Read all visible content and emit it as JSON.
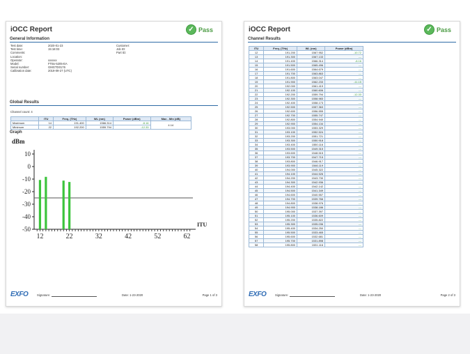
{
  "report_title": "iOCC Report",
  "pass_label": "Pass",
  "colors": {
    "accent": "#2d6aa5",
    "pass_green": "#4b9b43",
    "bar_green": "#3cc43c",
    "brand_blue": "#2f6cb5"
  },
  "page1": {
    "general_title": "General Information",
    "info_left": [
      {
        "key": "Test date:",
        "value": "2020-01-23"
      },
      {
        "key": "Test time:",
        "value": "15:18:03"
      },
      {
        "key": "Comments:",
        "value": ""
      },
      {
        "key": "Location:",
        "value": ""
      },
      {
        "key": "Operator:",
        "value": "xxxxxx"
      },
      {
        "key": "Model:",
        "value": "FTBx-5205-EA"
      },
      {
        "key": "Serial number:",
        "value": "GMGTD0176"
      },
      {
        "key": "Calibration date:",
        "value": "2019-09-27 (UTC)"
      }
    ],
    "info_right": [
      {
        "key": "Customer:",
        "value": ""
      },
      {
        "key": "Job ID:",
        "value": ""
      },
      {
        "key": "Part ID:",
        "value": ""
      }
    ],
    "global_title": "Global Results",
    "channel_count_label": "Channel count:",
    "channel_count": "4",
    "summary_headers": [
      "",
      "ITU",
      "Freq. (THz)",
      "WL (nm)",
      "Power (dBm)",
      "Max - Min (dB)"
    ],
    "summary_rows": [
      {
        "label": "Maximum",
        "itu": "14",
        "freq": "191.400",
        "wl": "1566.314",
        "power": "-8.16"
      },
      {
        "label": "Minimum",
        "itu": "22",
        "freq": "192.200",
        "wl": "1559.794",
        "power": "-12.33"
      }
    ],
    "max_min": "4.14",
    "graph_title": "Graph",
    "footer": {
      "signature_label": "Signature:",
      "date": "Date: 1-23-2020",
      "page": "Page 1 of 3"
    }
  },
  "chart_data": {
    "type": "bar",
    "ylabel": "dBm",
    "xlabel": "ITU",
    "ylim": [
      -50,
      10
    ],
    "xlim": [
      10,
      64
    ],
    "yticks": [
      10,
      0,
      -10,
      -20,
      -30,
      -40,
      -50
    ],
    "xticks": [
      12,
      22,
      32,
      42,
      52,
      62
    ],
    "threshold": -25,
    "x": [
      12,
      14,
      20,
      22
    ],
    "values": [
      -10.7,
      -8.2,
      -11.2,
      -12.3
    ]
  },
  "page2": {
    "channel_title": "Channel Results",
    "headers": [
      "ITU",
      "Freq. (THz)",
      "WL (nm)",
      "Power (dBm)"
    ],
    "rows": [
      [
        "12",
        "191.200",
        "1567.952",
        "-10.72"
      ],
      [
        "13",
        "191.300",
        "1567.133",
        "---"
      ],
      [
        "14",
        "191.400",
        "1566.314",
        "-8.16"
      ],
      [
        "15",
        "191.500",
        "1565.496",
        "---"
      ],
      [
        "16",
        "191.600",
        "1564.679",
        "---"
      ],
      [
        "17",
        "191.700",
        "1563.863",
        "---"
      ],
      [
        "18",
        "191.800",
        "1563.047",
        "---"
      ],
      [
        "19",
        "191.900",
        "1562.233",
        "-11.15"
      ],
      [
        "20",
        "192.000",
        "1561.419",
        "---"
      ],
      [
        "21",
        "192.100",
        "1560.606",
        "---"
      ],
      [
        "22",
        "192.200",
        "1559.794",
        "-12.33"
      ],
      [
        "23",
        "192.300",
        "1558.983",
        "---"
      ],
      [
        "24",
        "192.400",
        "1558.173",
        "---"
      ],
      [
        "25",
        "192.500",
        "1557.363",
        "---"
      ],
      [
        "26",
        "192.600",
        "1556.555",
        "---"
      ],
      [
        "27",
        "192.700",
        "1555.747",
        "---"
      ],
      [
        "28",
        "192.800",
        "1554.940",
        "---"
      ],
      [
        "29",
        "192.900",
        "1554.134",
        "---"
      ],
      [
        "30",
        "193.000",
        "1553.329",
        "---"
      ],
      [
        "31",
        "193.100",
        "1552.524",
        "---"
      ],
      [
        "32",
        "193.200",
        "1551.721",
        "---"
      ],
      [
        "33",
        "193.300",
        "1550.918",
        "---"
      ],
      [
        "34",
        "193.400",
        "1550.116",
        "---"
      ],
      [
        "35",
        "193.500",
        "1549.315",
        "---"
      ],
      [
        "36",
        "193.600",
        "1548.515",
        "---"
      ],
      [
        "37",
        "193.700",
        "1547.715",
        "---"
      ],
      [
        "38",
        "193.800",
        "1546.917",
        "---"
      ],
      [
        "39",
        "193.900",
        "1546.119",
        "---"
      ],
      [
        "40",
        "194.000",
        "1545.322",
        "---"
      ],
      [
        "41",
        "194.100",
        "1544.526",
        "---"
      ],
      [
        "42",
        "194.200",
        "1543.730",
        "---"
      ],
      [
        "43",
        "194.300",
        "1542.936",
        "---"
      ],
      [
        "44",
        "194.400",
        "1542.142",
        "---"
      ],
      [
        "45",
        "194.500",
        "1541.349",
        "---"
      ],
      [
        "46",
        "194.600",
        "1540.557",
        "---"
      ],
      [
        "47",
        "194.700",
        "1539.766",
        "---"
      ],
      [
        "48",
        "194.800",
        "1538.976",
        "---"
      ],
      [
        "49",
        "194.900",
        "1538.186",
        "---"
      ],
      [
        "50",
        "195.000",
        "1537.397",
        "---"
      ],
      [
        "51",
        "195.100",
        "1536.609",
        "---"
      ],
      [
        "52",
        "195.200",
        "1535.822",
        "---"
      ],
      [
        "53",
        "195.300",
        "1535.036",
        "---"
      ],
      [
        "54",
        "195.400",
        "1534.250",
        "---"
      ],
      [
        "55",
        "195.500",
        "1533.465",
        "---"
      ],
      [
        "56",
        "195.600",
        "1532.681",
        "---"
      ],
      [
        "57",
        "195.700",
        "1531.898",
        "---"
      ],
      [
        "58",
        "195.800",
        "1531.116",
        "---"
      ]
    ],
    "footer": {
      "signature_label": "Signature:",
      "date": "Date: 1-23-2020",
      "page": "Page 2 of 3"
    }
  },
  "logo_text": "EXFO"
}
